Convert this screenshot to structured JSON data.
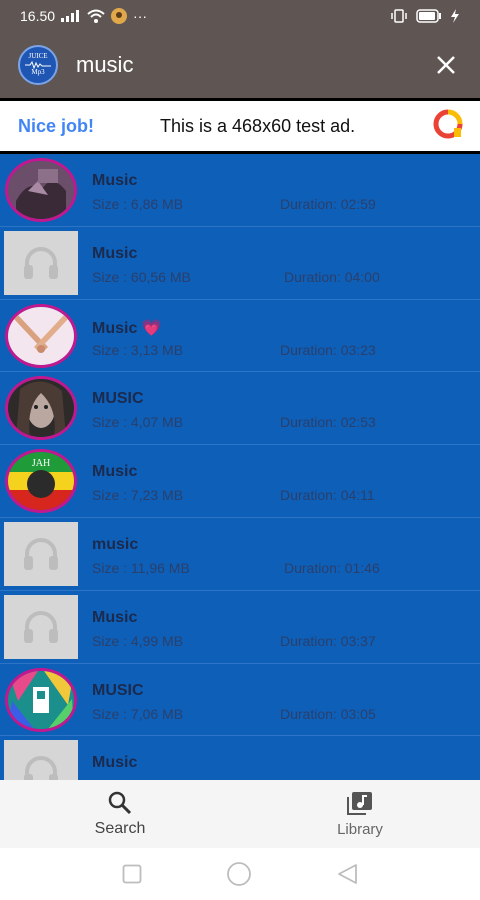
{
  "status_bar": {
    "time": "16.50",
    "dots": "···",
    "icons": [
      "signal-icon",
      "wifi-icon",
      "notification-avatar-icon",
      "vibrate-icon",
      "battery-icon",
      "charging-icon"
    ]
  },
  "app_bar": {
    "logo_text_top": "JUICE",
    "logo_text_bottom": "Mp3",
    "title": "music",
    "close_icon": "close-icon"
  },
  "ad": {
    "nice_job": "Nice job!",
    "text": "This is a 468x60 test ad."
  },
  "colors": {
    "list_bg": "#0d5fb8",
    "title_text": "#1b2a4d",
    "meta_text": "#2b3f6b",
    "thumb_border": "#c2188f"
  },
  "tracks": [
    {
      "title": "Music",
      "size": "Size : 6,86 MB",
      "duration": "Duration: 02:59",
      "thumb": "art-hands"
    },
    {
      "title": "Music",
      "size": "Size : 60,56 MB",
      "duration": "Duration: 04:00",
      "thumb": "placeholder"
    },
    {
      "title": "Music 💗",
      "size": "Size : 3,13 MB",
      "duration": "Duration: 03:23",
      "thumb": "art-crossed-hands"
    },
    {
      "title": "MUSIC",
      "size": "Size : 4,07 MB",
      "duration": "Duration: 02:53",
      "thumb": "art-portrait"
    },
    {
      "title": "Music",
      "size": "Size : 7,23 MB",
      "duration": "Duration: 04:11",
      "thumb": "art-reggae"
    },
    {
      "title": "music",
      "size": "Size : 11,96 MB",
      "duration": "Duration: 01:46",
      "thumb": "placeholder"
    },
    {
      "title": "Music",
      "size": "Size : 4,99 MB",
      "duration": "Duration: 03:37",
      "thumb": "placeholder"
    },
    {
      "title": "MUSIC",
      "size": "Size : 7,06 MB",
      "duration": "Duration: 03:05",
      "thumb": "art-colorful"
    },
    {
      "title": "Music",
      "size": "",
      "duration": "",
      "thumb": "placeholder"
    }
  ],
  "bottom_nav": {
    "search_label": "Search",
    "library_label": "Library"
  }
}
